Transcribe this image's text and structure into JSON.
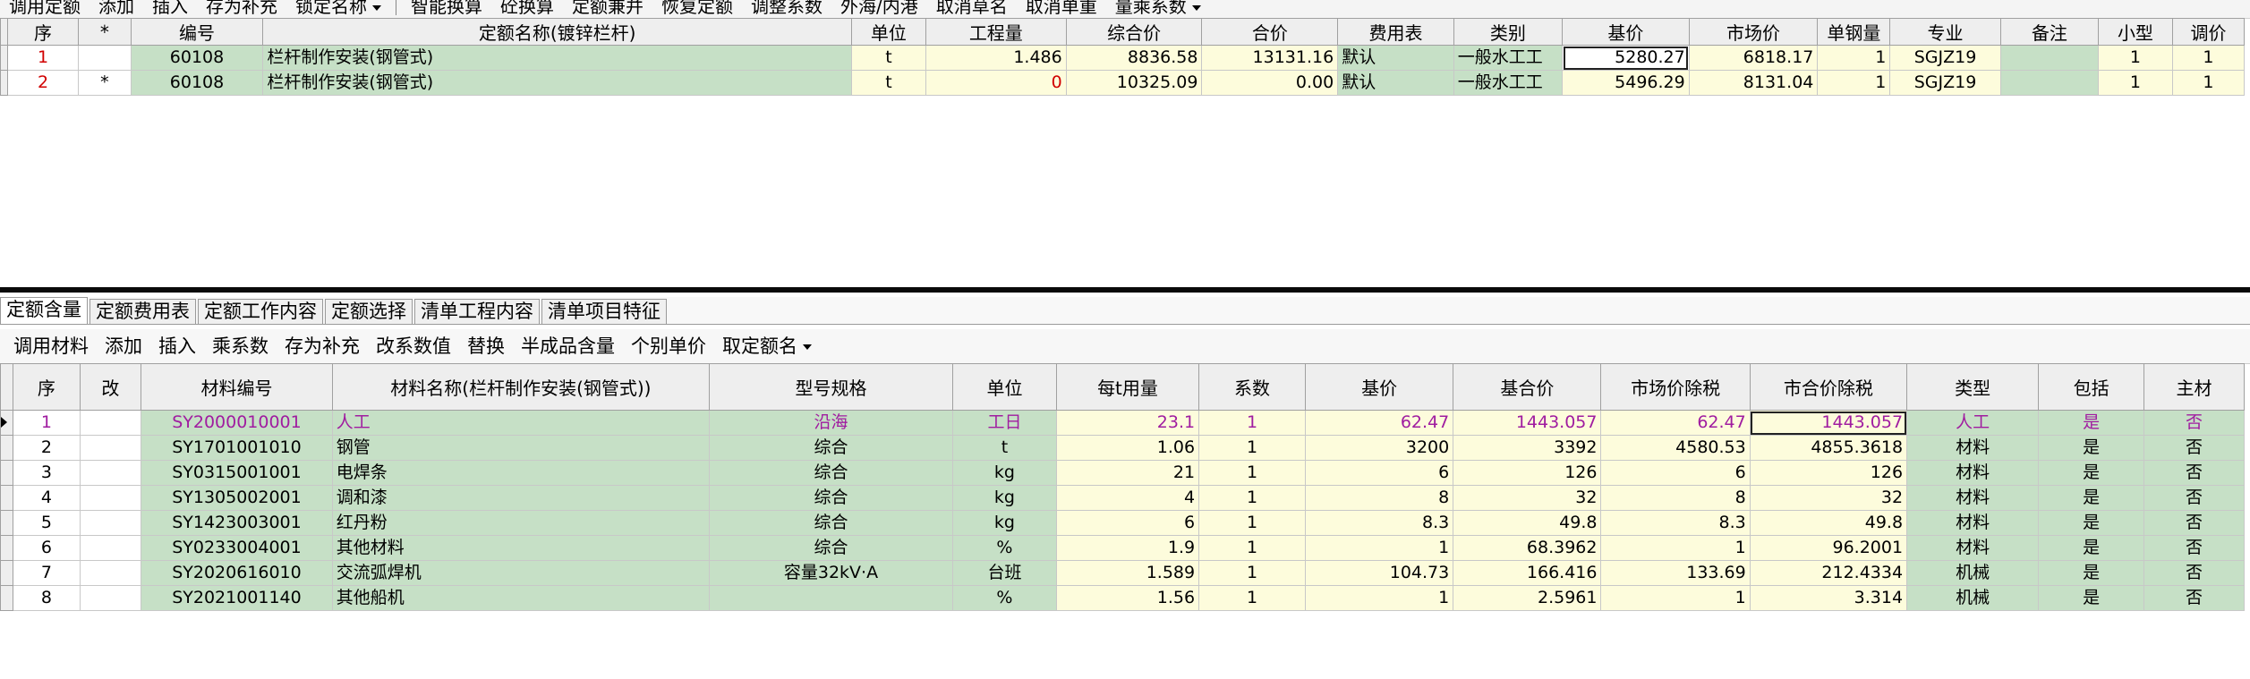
{
  "toolbar_top": {
    "items": [
      "调用定额",
      "添加",
      "插入",
      "存为补充",
      "锁定名称"
    ],
    "items2": [
      "智能换算",
      "砼换算",
      "定额兼并",
      "恢复定额",
      "调整系数",
      "外海/内港",
      "取消草名",
      "取消单重",
      "量乘系数"
    ]
  },
  "top_table": {
    "headers": [
      "序",
      "*",
      "编号",
      "定额名称(镀锌栏杆)",
      "单位",
      "工程量",
      "综合价",
      "合价",
      "费用表",
      "类别",
      "基价",
      "市场价",
      "单钢量",
      "专业",
      "备注",
      "小型",
      "调价"
    ],
    "rows": [
      {
        "seq": "1",
        "star": "",
        "code": "60108",
        "name": "栏杆制作安装(钢管式)",
        "unit": "t",
        "qty": "1.486",
        "comp": "8836.58",
        "total": "13131.16",
        "fee": "默认",
        "cat": "一般水工工",
        "base": "5280.27",
        "market": "6818.17",
        "steel": "1",
        "spec": "SGJZ19",
        "note": "",
        "small": "1",
        "adj": "1"
      },
      {
        "seq": "2",
        "star": "*",
        "code": "60108",
        "name": "栏杆制作安装(钢管式)",
        "unit": "t",
        "qty": "0",
        "comp": "10325.09",
        "total": "0.00",
        "fee": "默认",
        "cat": "一般水工工",
        "base": "5496.29",
        "market": "8131.04",
        "steel": "1",
        "spec": "SGJZ19",
        "note": "",
        "small": "1",
        "adj": "1"
      }
    ]
  },
  "tabs": [
    "定额含量",
    "定额费用表",
    "定额工作内容",
    "定额选择",
    "清单工程内容",
    "清单项目特征"
  ],
  "toolbar_bottom": {
    "items": [
      "调用材料",
      "添加",
      "插入",
      "乘系数",
      "存为补充",
      "改系数值",
      "替换",
      "半成品含量",
      "个别单价",
      "取定额名"
    ]
  },
  "bottom_table": {
    "headers": [
      "序",
      "改",
      "材料编号",
      "材料名称(栏杆制作安装(钢管式))",
      "型号规格",
      "单位",
      "每t用量",
      "系数",
      "基价",
      "基合价",
      "市场价除税",
      "市合价除税",
      "类型",
      "包括",
      "主材"
    ],
    "rows": [
      {
        "seq": "1",
        "mod": "",
        "code": "SY2000010001",
        "name": "人工",
        "model": "沿海",
        "unit": "工日",
        "usage": "23.1",
        "coef": "1",
        "base": "62.47",
        "base_total": "1443.057",
        "market": "62.47",
        "market_total": "1443.057",
        "type": "人工",
        "inc": "是",
        "main": "否"
      },
      {
        "seq": "2",
        "mod": "",
        "code": "SY1701001010",
        "name": "钢管",
        "model": "综合",
        "unit": "t",
        "usage": "1.06",
        "coef": "1",
        "base": "3200",
        "base_total": "3392",
        "market": "4580.53",
        "market_total": "4855.3618",
        "type": "材料",
        "inc": "是",
        "main": "否"
      },
      {
        "seq": "3",
        "mod": "",
        "code": "SY0315001001",
        "name": "电焊条",
        "model": "综合",
        "unit": "kg",
        "usage": "21",
        "coef": "1",
        "base": "6",
        "base_total": "126",
        "market": "6",
        "market_total": "126",
        "type": "材料",
        "inc": "是",
        "main": "否"
      },
      {
        "seq": "4",
        "mod": "",
        "code": "SY1305002001",
        "name": "调和漆",
        "model": "综合",
        "unit": "kg",
        "usage": "4",
        "coef": "1",
        "base": "8",
        "base_total": "32",
        "market": "8",
        "market_total": "32",
        "type": "材料",
        "inc": "是",
        "main": "否"
      },
      {
        "seq": "5",
        "mod": "",
        "code": "SY1423003001",
        "name": "红丹粉",
        "model": "综合",
        "unit": "kg",
        "usage": "6",
        "coef": "1",
        "base": "8.3",
        "base_total": "49.8",
        "market": "8.3",
        "market_total": "49.8",
        "type": "材料",
        "inc": "是",
        "main": "否"
      },
      {
        "seq": "6",
        "mod": "",
        "code": "SY0233004001",
        "name": "其他材料",
        "model": "综合",
        "unit": "%",
        "usage": "1.9",
        "coef": "1",
        "base": "1",
        "base_total": "68.3962",
        "market": "1",
        "market_total": "96.2001",
        "type": "材料",
        "inc": "是",
        "main": "否"
      },
      {
        "seq": "7",
        "mod": "",
        "code": "SY2020616010",
        "name": "交流弧焊机",
        "model": "容量32kV·A",
        "unit": "台班",
        "usage": "1.589",
        "coef": "1",
        "base": "104.73",
        "base_total": "166.416",
        "market": "133.69",
        "market_total": "212.4334",
        "type": "机械",
        "inc": "是",
        "main": "否"
      },
      {
        "seq": "8",
        "mod": "",
        "code": "SY2021001140",
        "name": "其他船机",
        "model": "",
        "unit": "%",
        "usage": "1.56",
        "coef": "1",
        "base": "1",
        "base_total": "2.5961",
        "market": "1",
        "market_total": "3.314",
        "type": "机械",
        "inc": "是",
        "main": "否"
      }
    ]
  }
}
